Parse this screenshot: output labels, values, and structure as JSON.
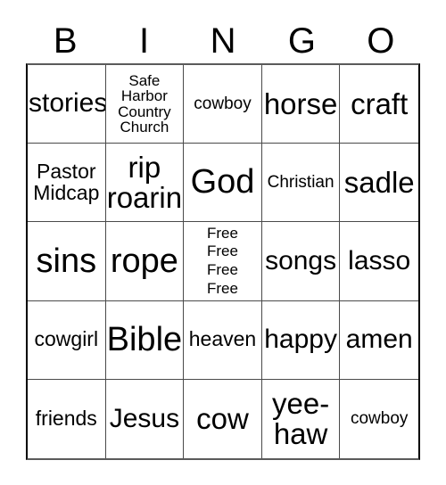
{
  "card": {
    "title_letters": [
      "B",
      "I",
      "N",
      "G",
      "O"
    ],
    "rows": [
      [
        {
          "text": "stories",
          "size": "fs-l"
        },
        {
          "text": "Safe\nHarbor\nCountry\nChurch",
          "size": "fs-xs"
        },
        {
          "text": "cowboy",
          "size": "fs-s"
        },
        {
          "text": "horse",
          "size": "fs-xl"
        },
        {
          "text": "craft",
          "size": "fs-xl"
        }
      ],
      [
        {
          "text": "Pastor\nMidcap",
          "size": "fs-m"
        },
        {
          "text": "rip\nroarin",
          "size": "fs-xl"
        },
        {
          "text": "God",
          "size": "fs-xxl"
        },
        {
          "text": "Christian",
          "size": "fs-s"
        },
        {
          "text": "sadle",
          "size": "fs-xl"
        }
      ],
      [
        {
          "text": "sins",
          "size": "fs-xxl"
        },
        {
          "text": "rope",
          "size": "fs-xxl"
        },
        {
          "text": "Free\nFree\nFree\nFree",
          "size": "fs-free"
        },
        {
          "text": "songs",
          "size": "fs-l"
        },
        {
          "text": "lasso",
          "size": "fs-l"
        }
      ],
      [
        {
          "text": "cowgirl",
          "size": "fs-m"
        },
        {
          "text": "Bible",
          "size": "fs-xxl"
        },
        {
          "text": "heaven",
          "size": "fs-m"
        },
        {
          "text": "happy",
          "size": "fs-l"
        },
        {
          "text": "amen",
          "size": "fs-l"
        }
      ],
      [
        {
          "text": "friends",
          "size": "fs-m"
        },
        {
          "text": "Jesus",
          "size": "fs-l"
        },
        {
          "text": "cow",
          "size": "fs-xl"
        },
        {
          "text": "yee-\nhaw",
          "size": "fs-xl"
        },
        {
          "text": "cowboy",
          "size": "fs-s"
        }
      ]
    ]
  },
  "colors": {
    "background": "#ffffff",
    "text": "#000000",
    "grid_line": "#4a4a4a",
    "grid_border": "#000000"
  }
}
